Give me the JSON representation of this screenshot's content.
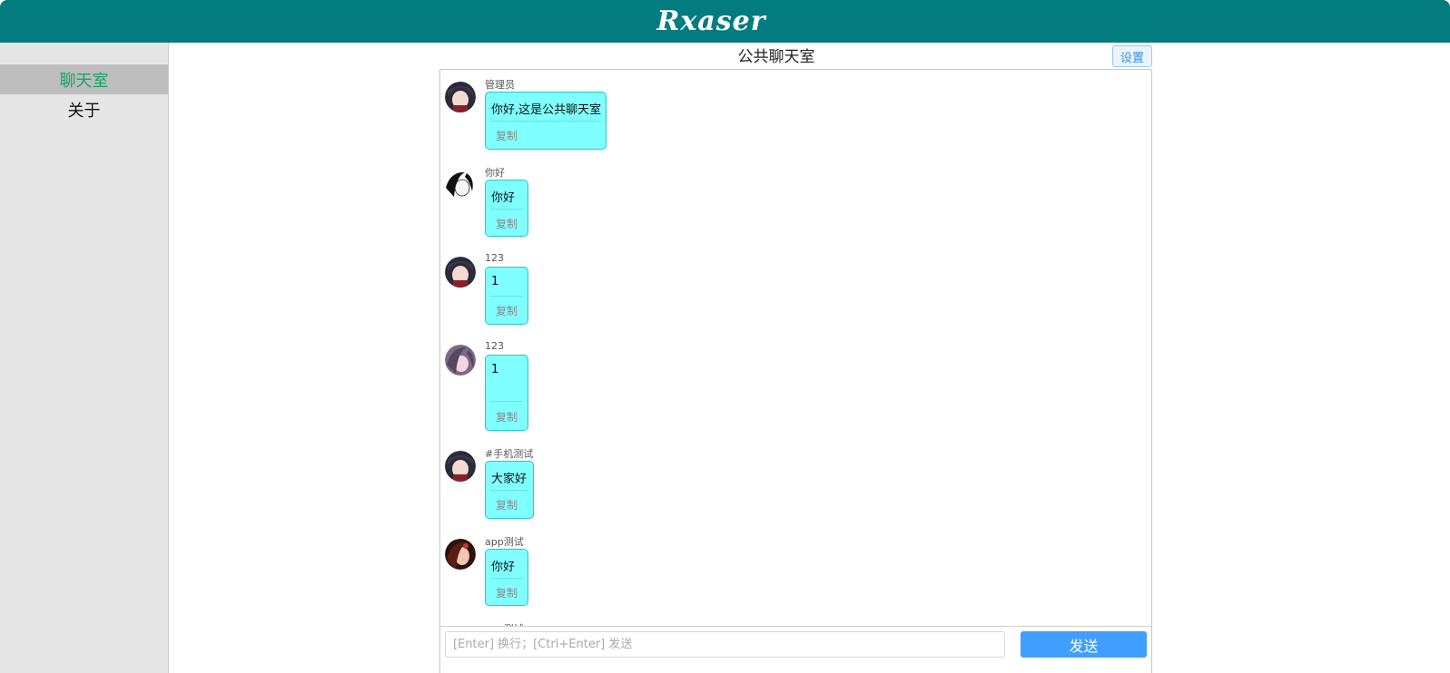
{
  "header": {
    "logo": "Rxaser"
  },
  "sidebar": {
    "items": [
      {
        "label": "聊天室",
        "active": true
      },
      {
        "label": "关于",
        "active": false
      }
    ]
  },
  "chat": {
    "title": "公共聊天室",
    "settings_label": "设置",
    "copy_label": "复制",
    "messages": [
      {
        "user": "管理员",
        "text": "你好,这是公共聊天室",
        "avatar": "anime-girl-dark-hair-icon"
      },
      {
        "user": "你好",
        "text": "你好",
        "avatar": "anime-girl-bw-icon"
      },
      {
        "user": "123",
        "text": "1",
        "avatar": "anime-girl-dark-hair-icon"
      },
      {
        "user": "123",
        "text": "1",
        "avatar": "anime-girl-purple-hair-icon"
      },
      {
        "user": "#手机测试",
        "text": "大家好",
        "avatar": "anime-girl-dark-hair-icon"
      },
      {
        "user": "app测试",
        "text": "你好",
        "avatar": "anime-girl-red-icon"
      },
      {
        "user": "app测试",
        "text": "",
        "avatar": "anime-girl-dark-hair-icon"
      }
    ],
    "input_placeholder": "[Enter] 换行；[Ctrl+Enter] 发送",
    "input_value": "",
    "send_label": "发送"
  },
  "colors": {
    "header_bg": "#027c7f",
    "bubble_bg": "#7fffff",
    "send_bg": "#409eff",
    "active_nav": "#16a36b"
  }
}
